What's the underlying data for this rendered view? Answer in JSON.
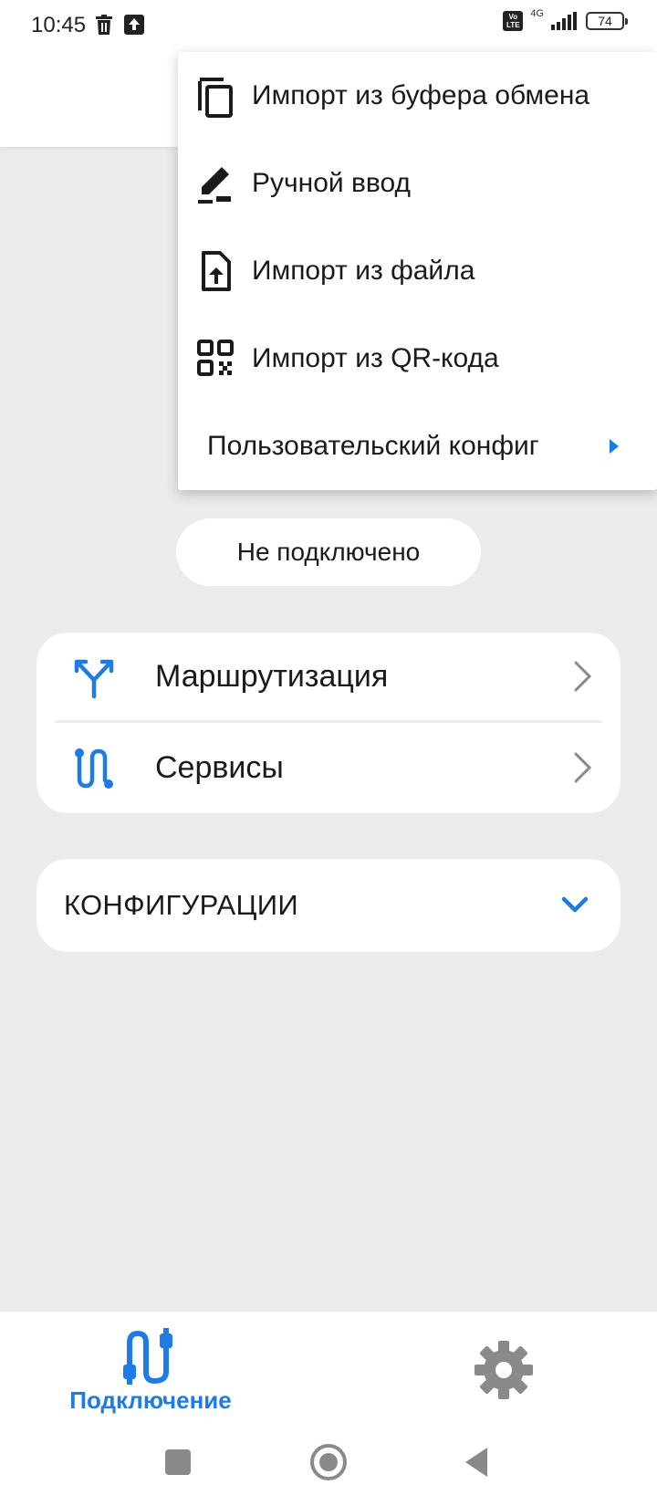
{
  "status_bar": {
    "time": "10:45",
    "left_icons": [
      "trash-icon",
      "upload-icon"
    ],
    "right_icons": [
      "volte-icon",
      "signal-4g-icon",
      "battery-icon"
    ],
    "volte_label": "VoLTE",
    "network_label": "4G",
    "battery_level": "74"
  },
  "menu": {
    "items": [
      {
        "label": "Импорт из буфера обмена",
        "icon": "clipboard-copy-icon"
      },
      {
        "label": "Ручной ввод",
        "icon": "edit-pen-icon"
      },
      {
        "label": "Импорт из файла",
        "icon": "file-upload-icon"
      },
      {
        "label": "Импорт из QR-кода",
        "icon": "qr-code-icon"
      },
      {
        "label": "Пользовательский конфиг",
        "icon": "submenu-arrow-icon"
      }
    ]
  },
  "connection_status": "Не подключено",
  "nav_card": {
    "routing_label": "Маршрутизация",
    "services_label": "Сервисы"
  },
  "configs": {
    "title": "КОНФИГУРАЦИИ"
  },
  "bottom_nav": {
    "connection_label": "Подключение",
    "active_tab": "connection"
  },
  "colors": {
    "accent": "#1e7be6",
    "background": "#ebebeb",
    "surface": "#ffffff",
    "icon_grey": "#8a8a8a"
  }
}
